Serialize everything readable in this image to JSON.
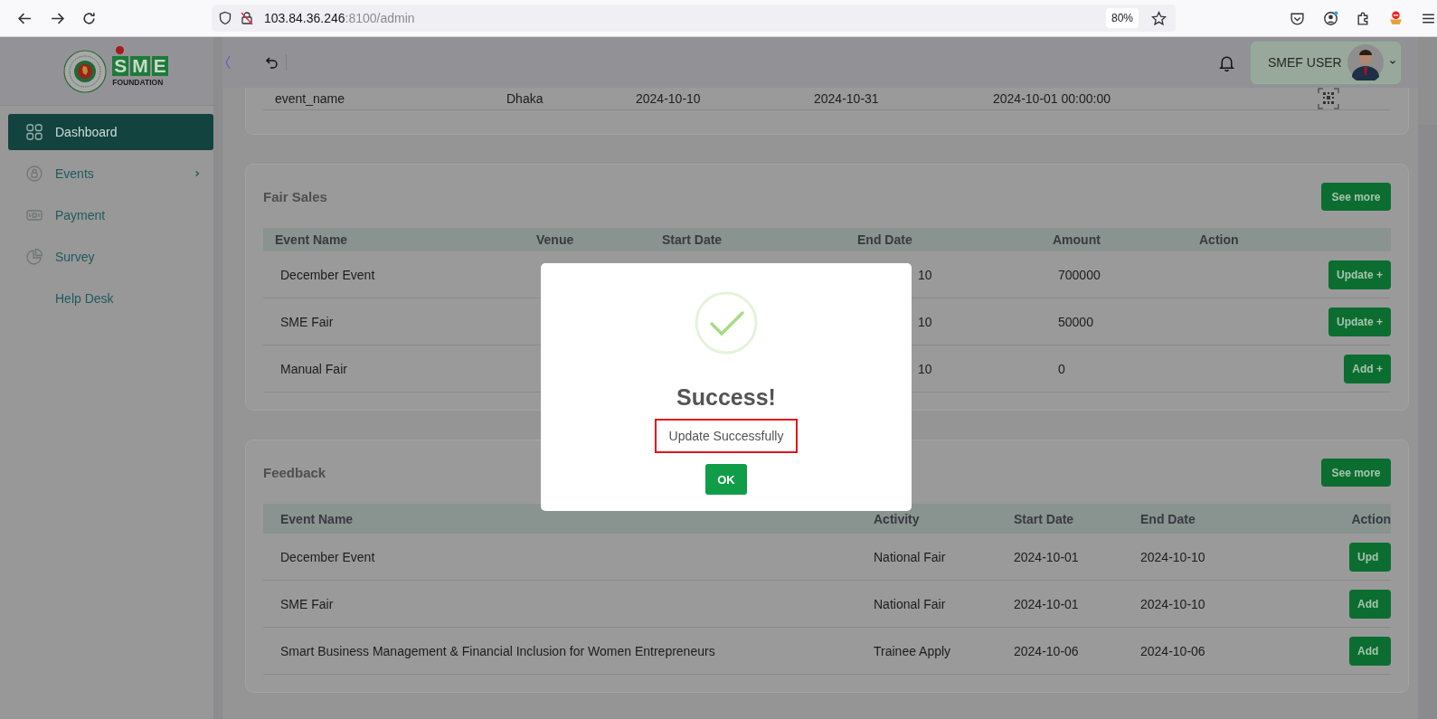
{
  "browser": {
    "url_host": "103.84.36.246",
    "url_path": ":8100/admin",
    "zoom": "80%"
  },
  "logo": {
    "letters": [
      "S",
      "M",
      "E"
    ],
    "tagline": "FOUNDATION"
  },
  "header": {
    "user_name": "SMEF USER"
  },
  "sidebar": {
    "items": [
      {
        "label": "Dashboard",
        "kind": "grid",
        "selected": true,
        "has_submenu": false
      },
      {
        "label": "Events",
        "kind": "lock",
        "selected": false,
        "has_submenu": true
      },
      {
        "label": "Payment",
        "kind": "cash",
        "selected": false,
        "has_submenu": false
      },
      {
        "label": "Survey",
        "kind": "pie",
        "selected": false,
        "has_submenu": false
      },
      {
        "label": "Help Desk",
        "kind": "plain",
        "selected": false,
        "has_submenu": false
      }
    ]
  },
  "events_table": {
    "rows": [
      {
        "cells": [
          "event_name",
          "Dhaka",
          "2024-10-10",
          "2024-10-31",
          "2024-10-01 00:00:00"
        ]
      }
    ]
  },
  "fair_sales": {
    "title": "Fair Sales",
    "see_more": "See more",
    "columns": [
      "Event Name",
      "Venue",
      "Start Date",
      "End Date",
      "Amount",
      "Action"
    ],
    "rows": [
      {
        "event_name": "December Event",
        "end_date": "10",
        "amount": "700000",
        "action": "Update +"
      },
      {
        "event_name": "SME Fair",
        "end_date": "10",
        "amount": "50000",
        "action": "Update +"
      },
      {
        "event_name": "Manual Fair",
        "end_date": "10",
        "amount": "0",
        "action": "Add +"
      }
    ]
  },
  "feedback": {
    "title": "Feedback",
    "see_more": "See more",
    "columns": [
      "Event Name",
      "Activity",
      "Start Date",
      "End Date",
      "Action"
    ],
    "rows": [
      {
        "cells": [
          "December Event",
          "National Fair",
          "2024-10-01",
          "2024-10-10"
        ],
        "action": "Upd"
      },
      {
        "cells": [
          "SME Fair",
          "National Fair",
          "2024-10-01",
          "2024-10-10"
        ],
        "action": "Add"
      },
      {
        "cells": [
          "Smart Business Management & Financial Inclusion for Women Entrepreneurs",
          "Trainee Apply",
          "2024-10-06",
          "2024-10-06"
        ],
        "action": "Add"
      }
    ]
  },
  "dialog": {
    "title": "Success!",
    "message": "Update Successfully",
    "button": "OK"
  }
}
